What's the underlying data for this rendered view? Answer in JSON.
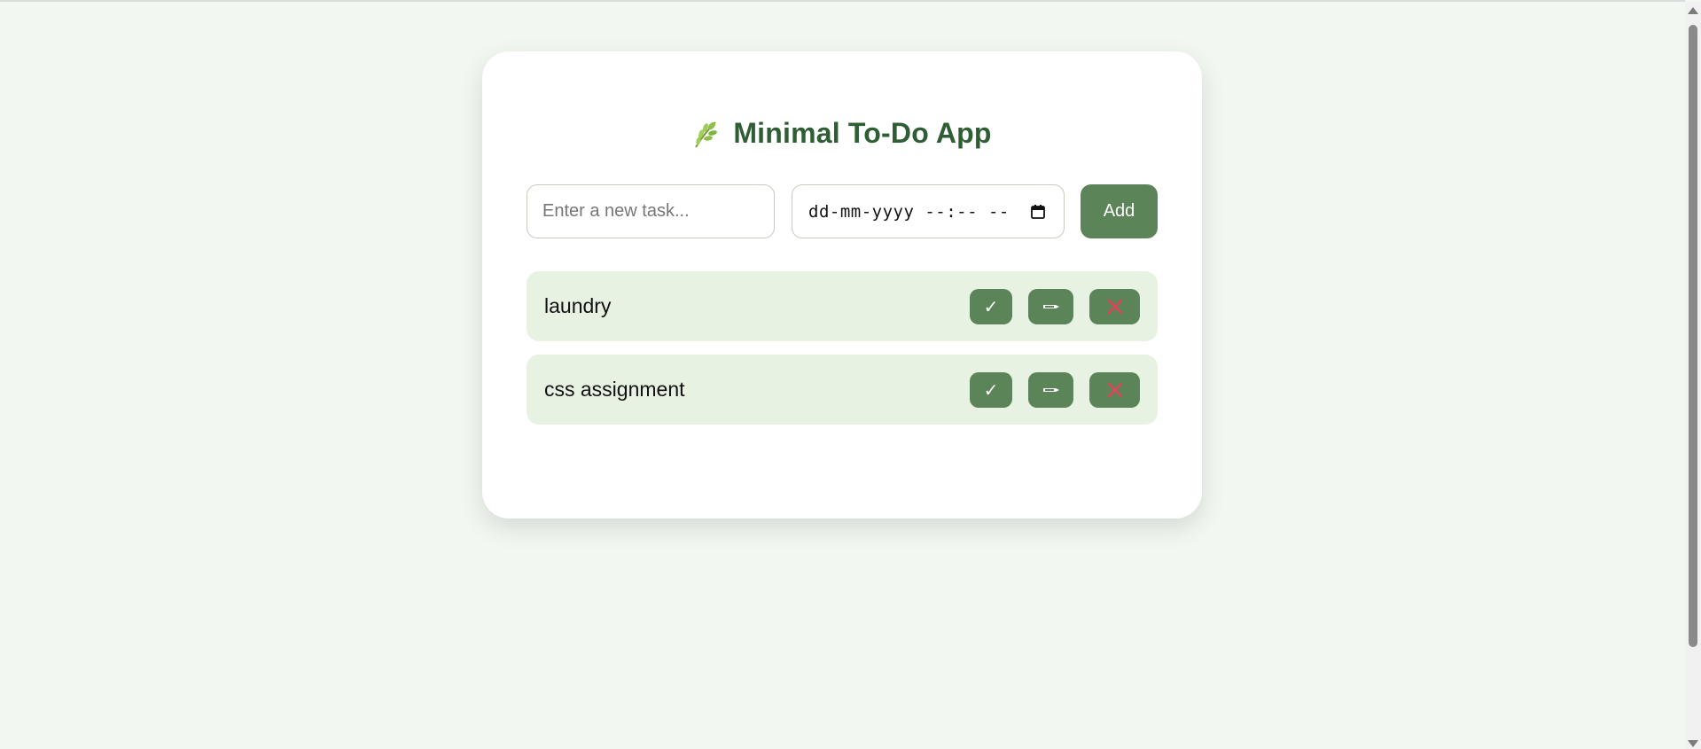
{
  "app": {
    "title": "Minimal To-Do App",
    "title_icon": "leaf-icon"
  },
  "form": {
    "task_placeholder": "Enter a new task...",
    "task_value": "",
    "datetime_placeholder": "dd-mm-yyyy --:-- --",
    "add_label": "Add"
  },
  "tasks": [
    {
      "label": "laundry",
      "done_icon": "checkmark-icon",
      "done_glyph": "✓",
      "edit_icon": "edit-icon",
      "delete_icon": "close-icon"
    },
    {
      "label": "css assignment",
      "done_icon": "checkmark-icon",
      "done_glyph": "✓",
      "edit_icon": "edit-icon",
      "delete_icon": "close-icon"
    }
  ],
  "colors": {
    "background": "#f2f7f2",
    "card": "#ffffff",
    "accent": "#5b8459",
    "title": "#2f5d34",
    "task_bg": "#e7f2e3",
    "delete_x": "#e0445a"
  }
}
